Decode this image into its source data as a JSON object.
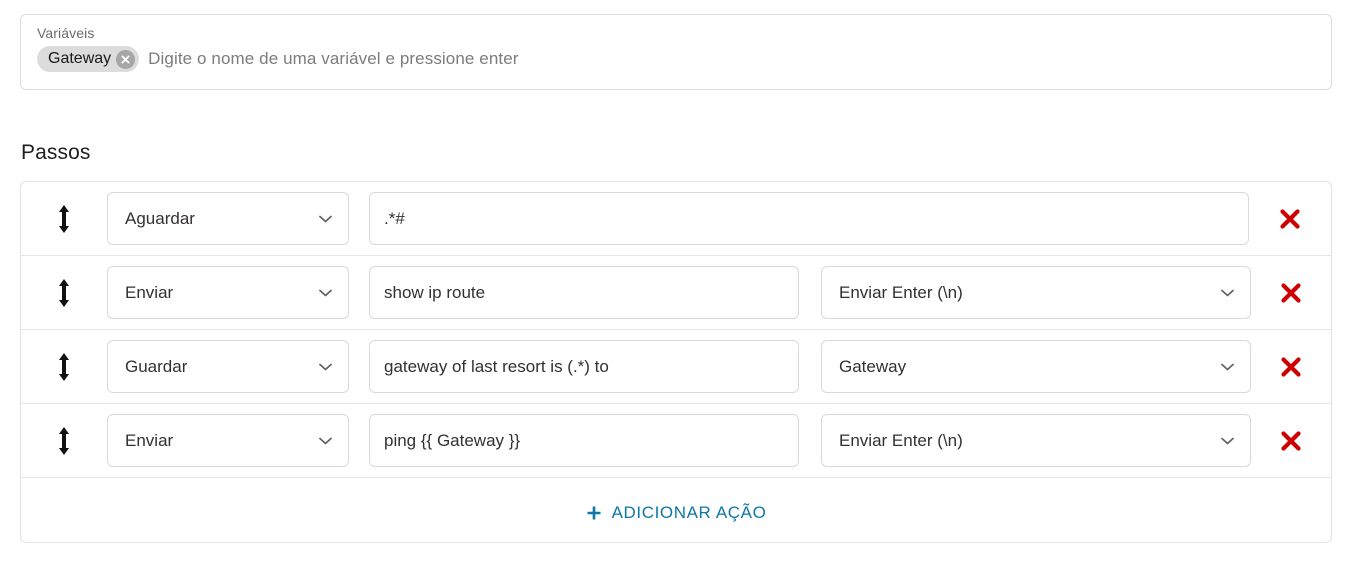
{
  "variables_panel": {
    "label": "Variáveis",
    "chips": [
      {
        "label": "Gateway",
        "remove_icon": "close-circle-icon"
      }
    ],
    "input_placeholder": "Digite o nome de uma variável e pressione enter",
    "input_value": ""
  },
  "steps_section": {
    "title": "Passos",
    "drag_icon": "drag-vertical-arrows-icon",
    "delete_icon": "close-x-icon",
    "chevron_icon": "chevron-down-icon",
    "add_action": {
      "label": "ADICIONAR AÇÃO",
      "icon": "plus-icon"
    },
    "rows": [
      {
        "action": "Aguardar",
        "value": ".*#",
        "value_placeholder": "",
        "option": null,
        "layout": "wide"
      },
      {
        "action": "Enviar",
        "value": "show ip route",
        "value_placeholder": "",
        "option": "Enviar Enter (\\n)",
        "layout": "three"
      },
      {
        "action": "Guardar",
        "value": "gateway of last resort is (.*) to",
        "value_placeholder": "",
        "option": "Gateway",
        "layout": "three"
      },
      {
        "action": "Enviar",
        "value": "ping {{ Gateway }}",
        "value_placeholder": "",
        "option": "Enviar Enter (\\n)",
        "layout": "three"
      }
    ]
  },
  "colors": {
    "accent_link": "#0f76a8",
    "delete_red": "#cc0000",
    "chip_background": "#dcdcdc",
    "chip_remove": "#a6a6a6",
    "border": "#d9d9d9",
    "placeholder_text": "#7c7c7c"
  }
}
